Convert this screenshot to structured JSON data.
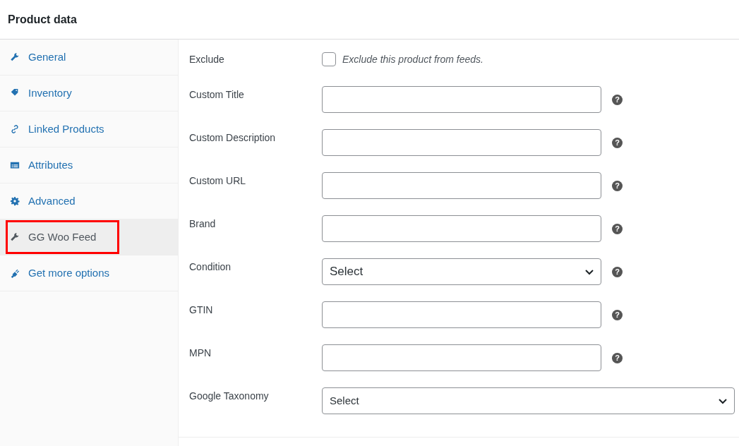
{
  "panel": {
    "title": "Product data"
  },
  "tabs": [
    {
      "label": "General",
      "selected": false,
      "annotated": false
    },
    {
      "label": "Inventory",
      "selected": false,
      "annotated": false
    },
    {
      "label": "Linked Products",
      "selected": false,
      "annotated": false
    },
    {
      "label": "Attributes",
      "selected": false,
      "annotated": false
    },
    {
      "label": "Advanced",
      "selected": false,
      "annotated": false
    },
    {
      "label": "GG Woo Feed",
      "selected": true,
      "annotated": true
    },
    {
      "label": "Get more options",
      "selected": false,
      "annotated": false
    }
  ],
  "fields": [
    {
      "kind": "checkbox",
      "label": "Exclude",
      "checked": false,
      "description": "Exclude this product from feeds."
    },
    {
      "kind": "text",
      "label": "Custom Title",
      "help": "?"
    },
    {
      "kind": "text",
      "label": "Custom Description",
      "help": "?"
    },
    {
      "kind": "text",
      "label": "Custom URL",
      "help": "?"
    },
    {
      "kind": "text",
      "label": "Brand",
      "help": "?"
    },
    {
      "kind": "select",
      "label": "Condition",
      "value": "Select",
      "help": "?"
    },
    {
      "kind": "text",
      "label": "GTIN",
      "help": "?"
    },
    {
      "kind": "text",
      "label": "MPN",
      "help": "?"
    },
    {
      "kind": "wide-select",
      "label": "Google Taxonomy",
      "value": "Select"
    }
  ]
}
